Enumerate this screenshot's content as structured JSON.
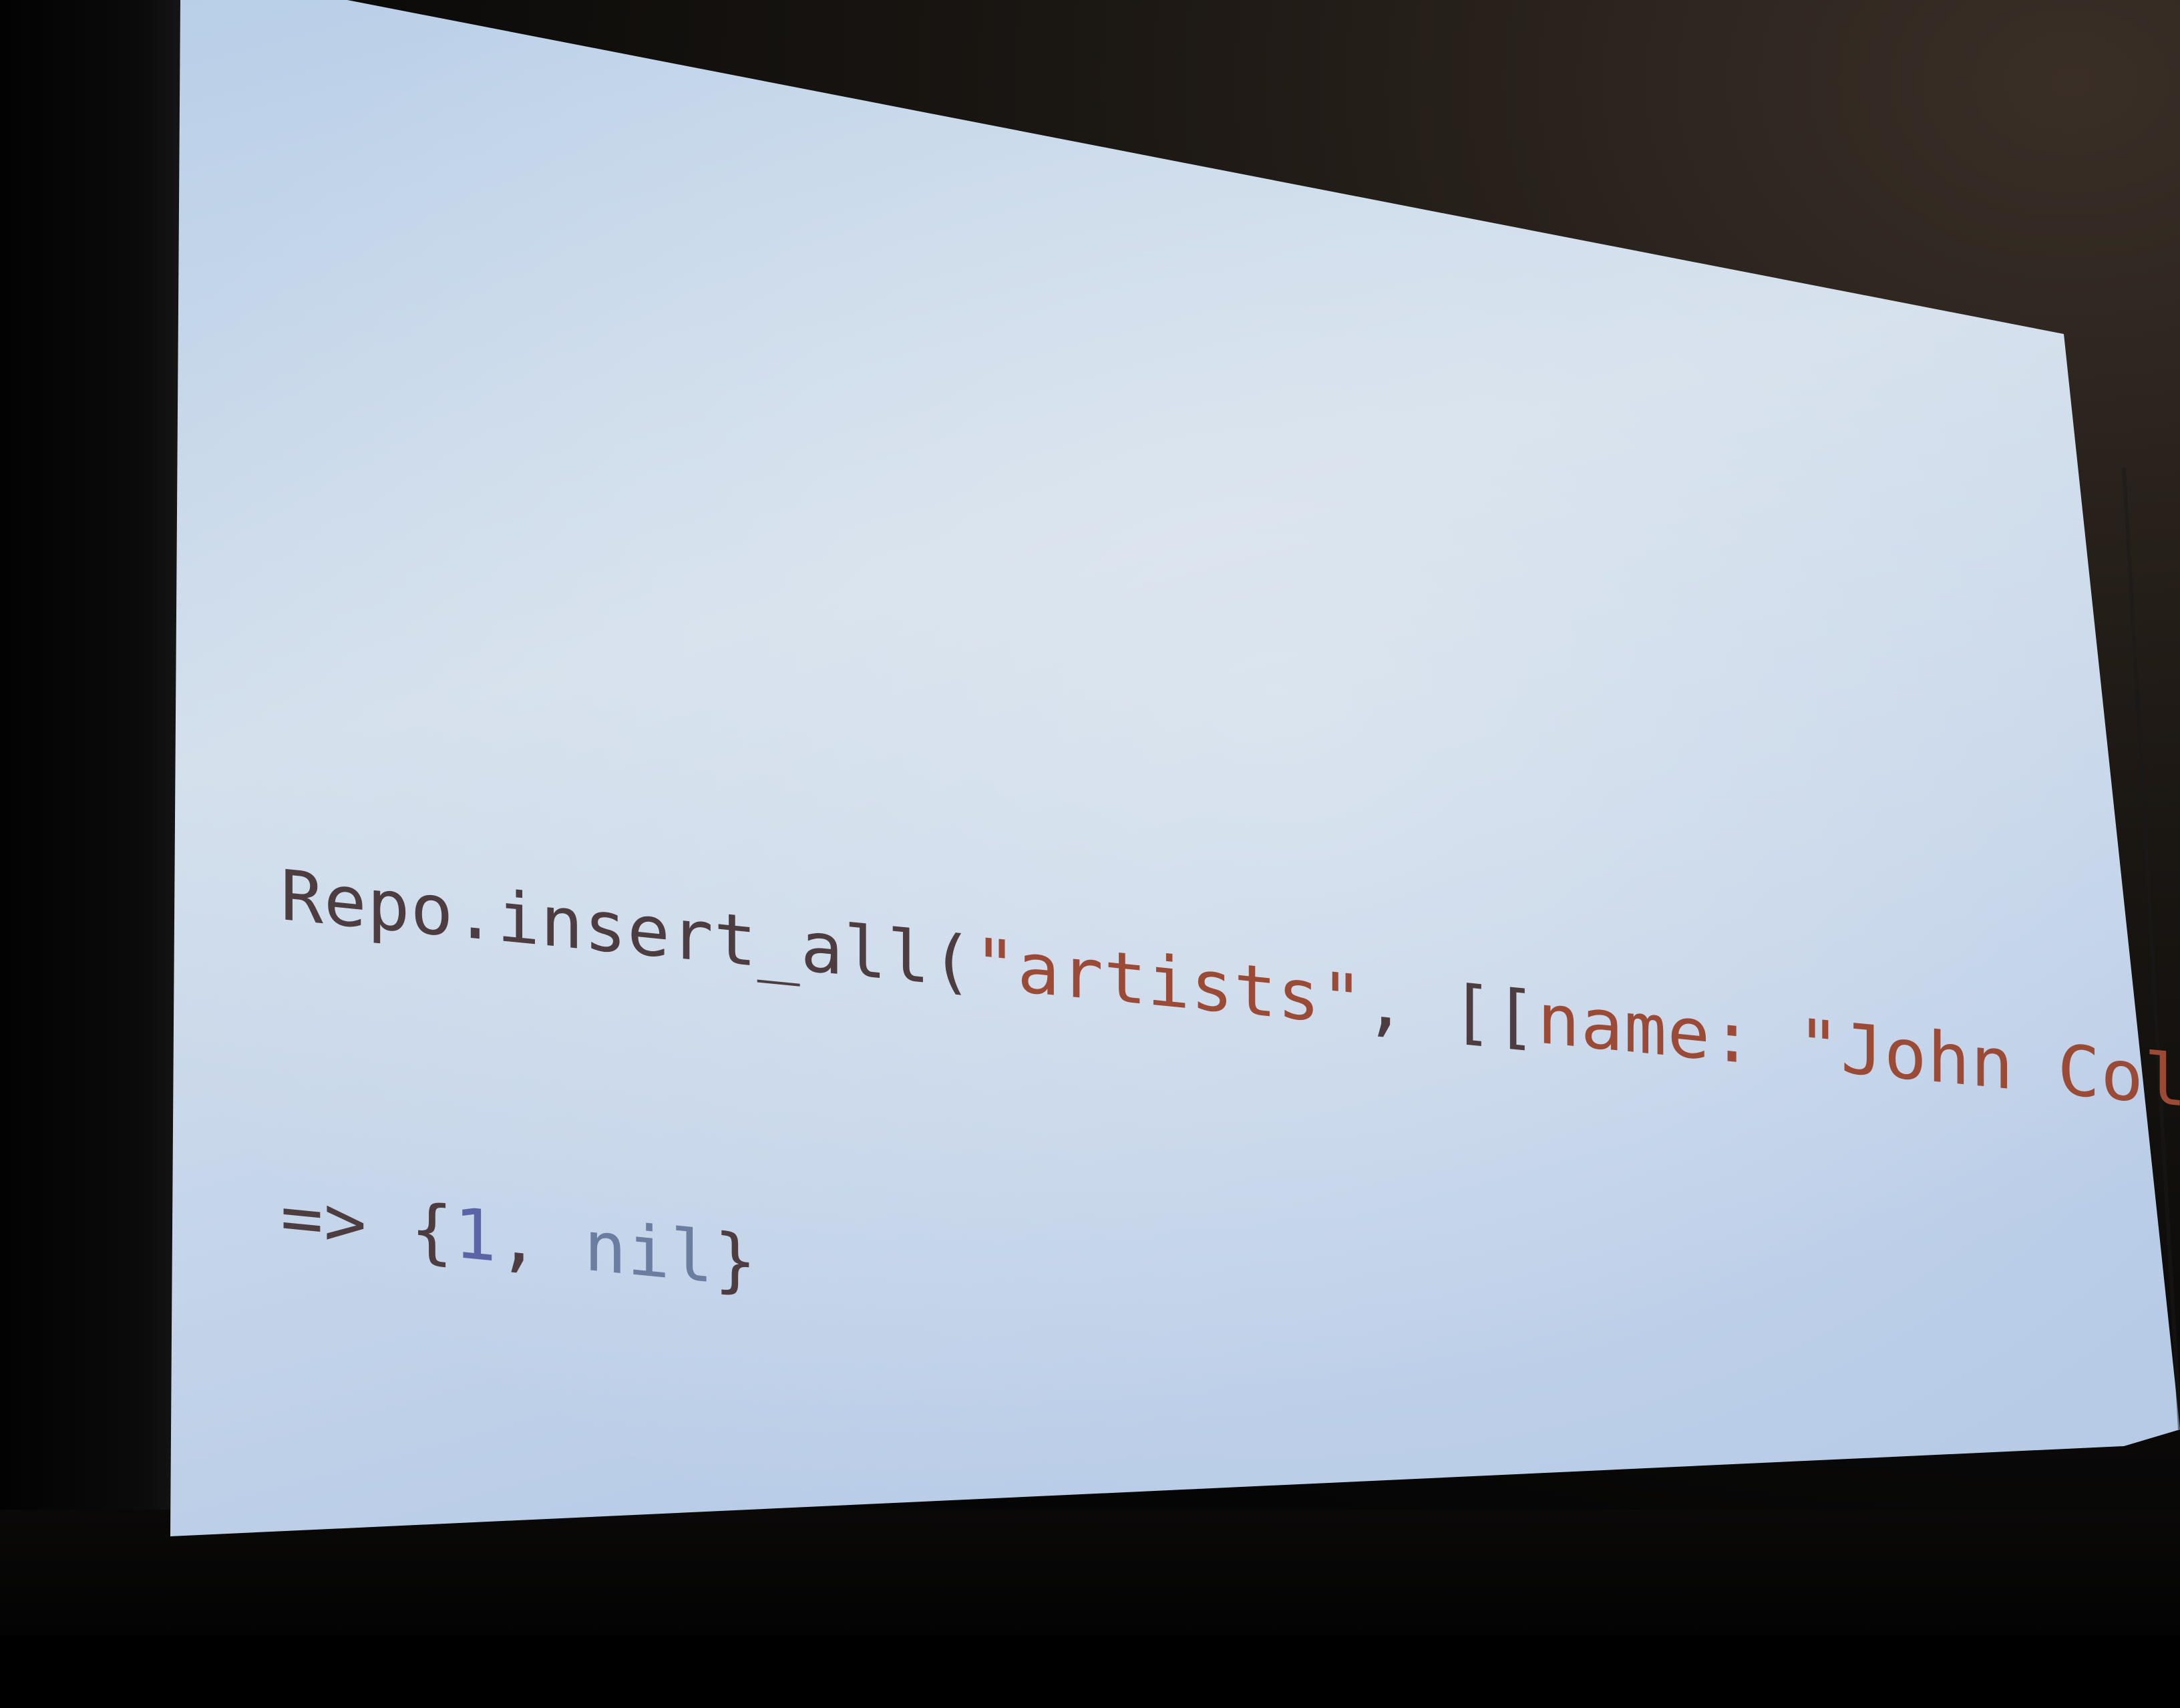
{
  "photo": {
    "subject": "projected presentation slide",
    "colors": {
      "screen_light": "#cfdcec",
      "screen_mid": "#b6cbe6",
      "surround": "#050505",
      "code_default": "#4d3d40",
      "code_string": "#9b4a36",
      "code_number": "#5a64a6",
      "code_nil": "#6b7ea0"
    }
  },
  "slide": {
    "code_line_1": {
      "call": "Repo.insert_all(",
      "table": "\"artists\"",
      "sep": ", ",
      "open": "[[",
      "key": "name:",
      "space": " ",
      "value": "\"John Coltrane\"",
      "close": "]])"
    },
    "code_line_2": {
      "arrow": "=> ",
      "brace_open": "{",
      "count": "1",
      "comma": ", ",
      "nil": "nil",
      "brace_close": "}"
    }
  }
}
